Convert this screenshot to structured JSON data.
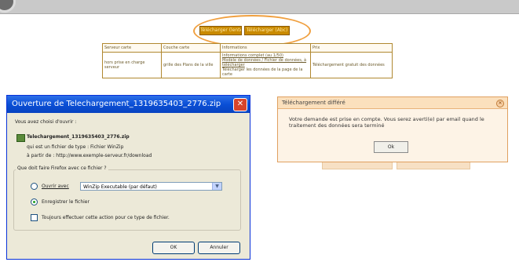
{
  "top_buttons": [
    "Télécharger (lente)",
    "Télécharger (Abc)"
  ],
  "table": {
    "headers": [
      "Serveur carte",
      "Couche carte",
      "Informations",
      "Prix"
    ],
    "row": {
      "server": "hors prise en charge serveur",
      "layer": "grille des Plans de la ville",
      "info_lines": [
        "Informations complet (au 1/50)",
        "Modèle de données / Fichier de données, à télécharger",
        "Télécharger les données de la page de la carte"
      ],
      "price": "Téléchargement gratuit des données"
    }
  },
  "download_dialog": {
    "title": "Ouverture de Telechargement_1319635403_2776.zip",
    "intro": "Vous avez choisi d'ouvrir :",
    "file_name": "Telechargement_1319635403_2776.zip",
    "type_line": "qui est un fichier de type : Fichier WinZip",
    "source_line": "à partir de : http://www.exemple-serveur.fr/download",
    "question": "Que doit faire Firefox avec ce fichier ?",
    "open_with_label": "Ouvrir avec",
    "open_with_value": "WinZip Executable (par défaut)",
    "save_label": "Enregistrer le fichier",
    "remember_label": "Toujours effectuer cette action pour ce type de fichier.",
    "ok": "OK",
    "cancel": "Annuler"
  },
  "deferred_dialog": {
    "title": "Téléchargement différé",
    "message": "Votre demande est prise en compte. Vous serez averti(e) par email quand le traitement des données sera terminé",
    "ok": "Ok"
  },
  "colors": {
    "accent_orange": "#f0a040",
    "button_gold": "#c98a00",
    "xp_blue": "#0a4fd6"
  }
}
